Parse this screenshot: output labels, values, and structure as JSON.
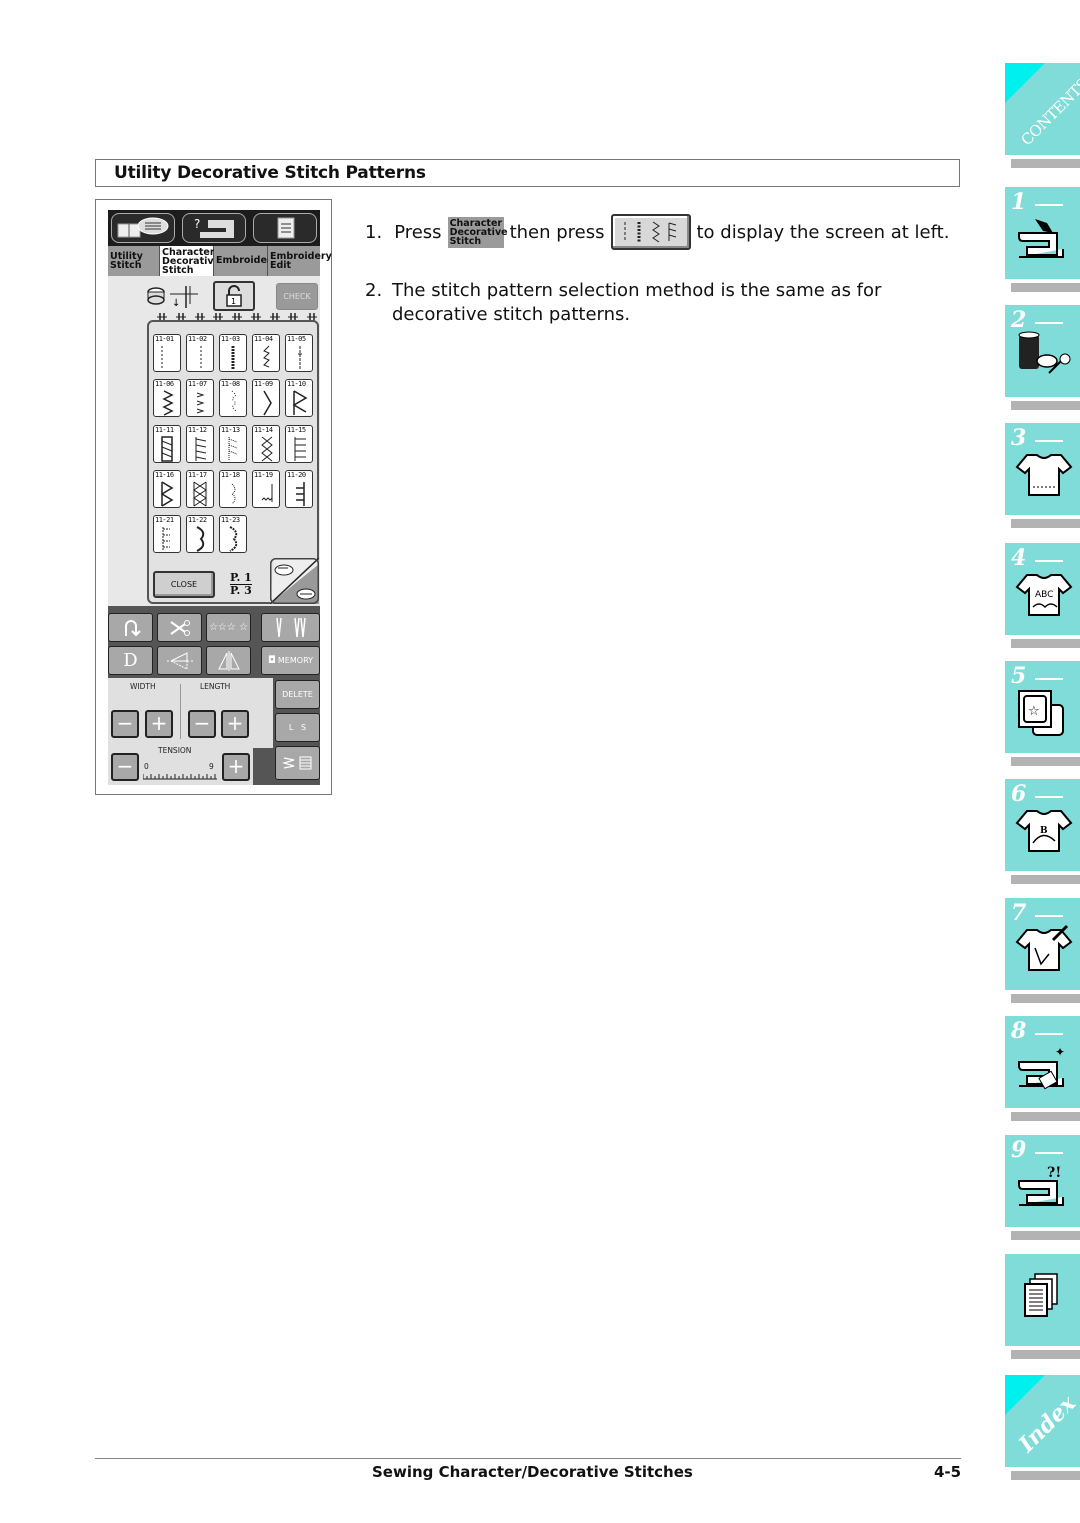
{
  "section": {
    "title": "Utility Decorative Stitch Patterns"
  },
  "instructions": {
    "step1": {
      "num": "1.",
      "press": "Press",
      "chip_lines": [
        "Character",
        "Decorative",
        "Stitch"
      ],
      "then_press": "then press",
      "after": "to display the screen at left."
    },
    "step2": {
      "num": "2.",
      "text": "The stitch pattern selection method is the same as for decorative stitch patterns."
    }
  },
  "lcd": {
    "top_icons": [
      "book-icon",
      "help-machine-icon",
      "checklist-icon"
    ],
    "tabs": [
      {
        "label_lines": [
          "Utility",
          "Stitch"
        ],
        "active": false
      },
      {
        "label_lines": [
          "Character",
          "Decorative",
          "Stitch"
        ],
        "active": true
      },
      {
        "label_lines": [
          "Embroidery"
        ],
        "active": false
      },
      {
        "label_lines": [
          "Embroidery",
          "Edit"
        ],
        "active": false
      }
    ],
    "check_label": "CHECK",
    "patterns": [
      "11-01",
      "11-02",
      "11-03",
      "11-04",
      "11-05",
      "11-06",
      "11-07",
      "11-08",
      "11-09",
      "11-10",
      "11-11",
      "11-12",
      "11-13",
      "11-14",
      "11-15",
      "11-16",
      "11-17",
      "11-18",
      "11-19",
      "11-20",
      "11-21",
      "11-22",
      "11-23"
    ],
    "close_label": "CLOSE",
    "page_current": "P. 1",
    "page_total": "P. 3",
    "controls": {
      "memory_label": "MEMORY",
      "delete_label": "DELETE",
      "ls_label": "L   S",
      "width_label": "WIDTH",
      "length_label": "LENGTH",
      "tension_label": "TENSION",
      "tension_min": "0",
      "tension_max": "9",
      "minus": "−",
      "plus": "+"
    }
  },
  "side_tabs": [
    {
      "label": "CONTENTS",
      "type": "corner"
    },
    {
      "label": "1",
      "icon": "sewing-machine-hand-icon"
    },
    {
      "label": "2",
      "icon": "thread-scissors-icon"
    },
    {
      "label": "3",
      "icon": "shirt-stitch-icon"
    },
    {
      "label": "4",
      "icon": "shirt-abc-icon"
    },
    {
      "label": "5",
      "icon": "embroidery-hoop-icon"
    },
    {
      "label": "6",
      "icon": "shirt-monogram-icon"
    },
    {
      "label": "7",
      "icon": "shirt-edit-icon"
    },
    {
      "label": "8",
      "icon": "machine-maintenance-icon"
    },
    {
      "label": "9",
      "icon": "machine-troubleshoot-icon"
    },
    {
      "label": "",
      "icon": "documents-icon"
    },
    {
      "label": "Index",
      "type": "corner"
    }
  ],
  "footer": {
    "title": "Sewing Character/Decorative Stitches",
    "page": "4-5"
  },
  "colors": {
    "tab_teal": "#7fdcd9",
    "tab_corner": "#00f0f0",
    "tab_shadow": "#b3b3b3",
    "lcd_gray": "#9a9a9a"
  }
}
